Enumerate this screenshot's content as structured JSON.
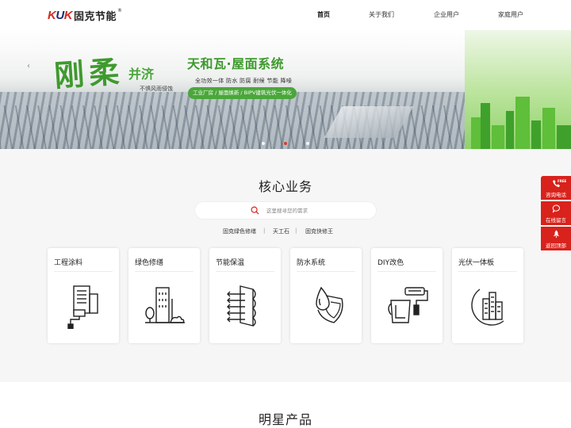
{
  "header": {
    "logo_brand_1": "K",
    "logo_brand_2": "U",
    "logo_brand_3": "K",
    "logo_text": "固克节能",
    "logo_reg": "®",
    "nav": [
      {
        "label": "首页",
        "active": true
      },
      {
        "label": "关于我们",
        "active": false
      },
      {
        "label": "企业用户",
        "active": false
      },
      {
        "label": "家庭用户",
        "active": false
      }
    ]
  },
  "banner": {
    "big_text": "刚柔",
    "big_text_2": "并济",
    "sub_text": "不惧风雨侵蚀",
    "title": "天和瓦·屋面系统",
    "features": "全功效一体  防水  防腐  耐候  节能  降噪",
    "pill": "工业厂房 / 屋面焕新 / BIPV建筑光伏一体化",
    "prev_arrow": "‹",
    "next_arrow": "›",
    "slide_count": 3,
    "active_slide": 1
  },
  "core": {
    "title": "核心业务",
    "search_placeholder": "这里搜寻您的需求",
    "hot_links": [
      "固克绿色修缮",
      "天工石",
      "固克快修王"
    ],
    "separator": "|",
    "cards": [
      {
        "title": "工程涂料",
        "icon": "building-roller-icon"
      },
      {
        "title": "绿色修缮",
        "icon": "tower-tree-icon"
      },
      {
        "title": "节能保温",
        "icon": "insulation-wall-icon"
      },
      {
        "title": "防水系统",
        "icon": "waterdrop-shield-icon"
      },
      {
        "title": "DIY改色",
        "icon": "paint-roller-bucket-icon"
      },
      {
        "title": "光伏一体板",
        "icon": "moon-city-icon"
      }
    ]
  },
  "products": {
    "title": "明星产品"
  },
  "side_tools": [
    {
      "label": "咨询电话",
      "icon": "phone-icon",
      "badge": "FREE"
    },
    {
      "label": "在线留言",
      "icon": "chat-bubble-icon"
    },
    {
      "label": "返回顶部",
      "icon": "rocket-icon"
    }
  ],
  "colors": {
    "brand_red": "#d8221b",
    "brand_green": "#4aa73a",
    "logo_blue": "#1e2a78"
  }
}
